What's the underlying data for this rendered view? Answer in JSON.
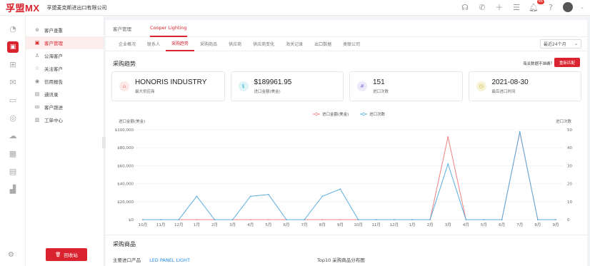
{
  "header": {
    "logo": "孚盟MX",
    "company": "孚盟麦克斯进出口有限公司",
    "notification_count": "66"
  },
  "rail": {
    "icons": [
      "pie-chart-icon",
      "customer-icon",
      "hierarchy-icon",
      "mail-icon",
      "inbox-icon",
      "compass-icon",
      "cloud-icon",
      "building-icon",
      "document-icon",
      "chart-icon"
    ]
  },
  "subnav": {
    "items": [
      {
        "label": "客户查重",
        "icon": "⊛"
      },
      {
        "label": "客户管理",
        "icon": "▣"
      },
      {
        "label": "公海客户",
        "icon": "♙"
      },
      {
        "label": "关注客户",
        "icon": "☆"
      },
      {
        "label": "信用报告",
        "icon": "◉"
      },
      {
        "label": "通讯录",
        "icon": "▤"
      },
      {
        "label": "客户跟进",
        "icon": "ꝏ"
      },
      {
        "label": "工单中心",
        "icon": "▥"
      }
    ],
    "recycle_label": "回收站"
  },
  "tabs": {
    "primary": [
      {
        "label": "客户管理",
        "active": false
      },
      {
        "label": "Cooper Lighting",
        "active": true
      }
    ],
    "secondary": [
      {
        "label": "企业概况",
        "active": false
      },
      {
        "label": "联系人",
        "active": false
      },
      {
        "label": "采购趋势",
        "active": true
      },
      {
        "label": "采购商品",
        "active": false
      },
      {
        "label": "供应商",
        "active": false
      },
      {
        "label": "供应商变化",
        "active": false
      },
      {
        "label": "海关记录",
        "active": false
      },
      {
        "label": "出口数据",
        "active": false
      },
      {
        "label": "类联公司",
        "active": false
      }
    ],
    "range": "最近24个月"
  },
  "trend": {
    "title": "采购趋势",
    "inaccurate": "海关数据不准确？",
    "rematch": "重新匹配",
    "cards": [
      {
        "value": "HONORIS INDUSTRY",
        "label": "最大供应商",
        "color": "#f08080",
        "bg": "#fde8e8",
        "icon": "⌂"
      },
      {
        "value": "$189961.95",
        "label": "进口金额(美金)",
        "color": "#33b5c9",
        "bg": "#dff4f7",
        "icon": "$"
      },
      {
        "value": "151",
        "label": "进口次数",
        "color": "#8a7ae0",
        "bg": "#ece9fb",
        "icon": "#"
      },
      {
        "value": "2021-08-30",
        "label": "最后进口时间",
        "color": "#c9b62f",
        "bg": "#f7f3d6",
        "icon": "◷"
      }
    ]
  },
  "chart_data": {
    "type": "line",
    "categories": [
      "10月",
      "11月",
      "12月",
      "1月",
      "2月",
      "3月",
      "4月",
      "5月",
      "6月",
      "7月",
      "8月",
      "9月",
      "10月",
      "11月",
      "12月",
      "1月",
      "2月",
      "3月",
      "4月",
      "5月",
      "6月",
      "7月",
      "8月",
      "9月"
    ],
    "series": [
      {
        "name": "进口金额(美金)",
        "axis": "left",
        "color": "#f08080",
        "values": [
          0,
          0,
          0,
          0,
          0,
          0,
          0,
          0,
          0,
          0,
          0,
          0,
          0,
          0,
          0,
          0,
          0,
          92000,
          0,
          0,
          0,
          97000,
          0,
          0
        ]
      },
      {
        "name": "进口次数",
        "axis": "right",
        "color": "#5aaee0",
        "values": [
          0,
          0,
          0,
          13,
          0,
          0,
          13,
          14,
          0,
          0,
          13,
          17,
          0,
          0,
          0,
          0,
          0,
          31,
          0,
          0,
          0,
          49,
          0,
          0
        ]
      }
    ],
    "left_axis": {
      "label": "进口金额(美金)",
      "ticks": [
        "$0",
        "$20,000",
        "$40,000",
        "$60,000",
        "$80,000",
        "$100,000"
      ],
      "ylim": [
        0,
        100000
      ]
    },
    "right_axis": {
      "label": "进口次数",
      "ticks": [
        "0",
        "10",
        "20",
        "30",
        "40",
        "50"
      ],
      "ylim": [
        0,
        50
      ]
    },
    "legend": "top-center",
    "grid": true
  },
  "products": {
    "title": "采购商品",
    "main_label": "主要进口产品",
    "main_value": "LED PANEL LIGHT",
    "top10_label": "Top10 采购商品分布图"
  }
}
